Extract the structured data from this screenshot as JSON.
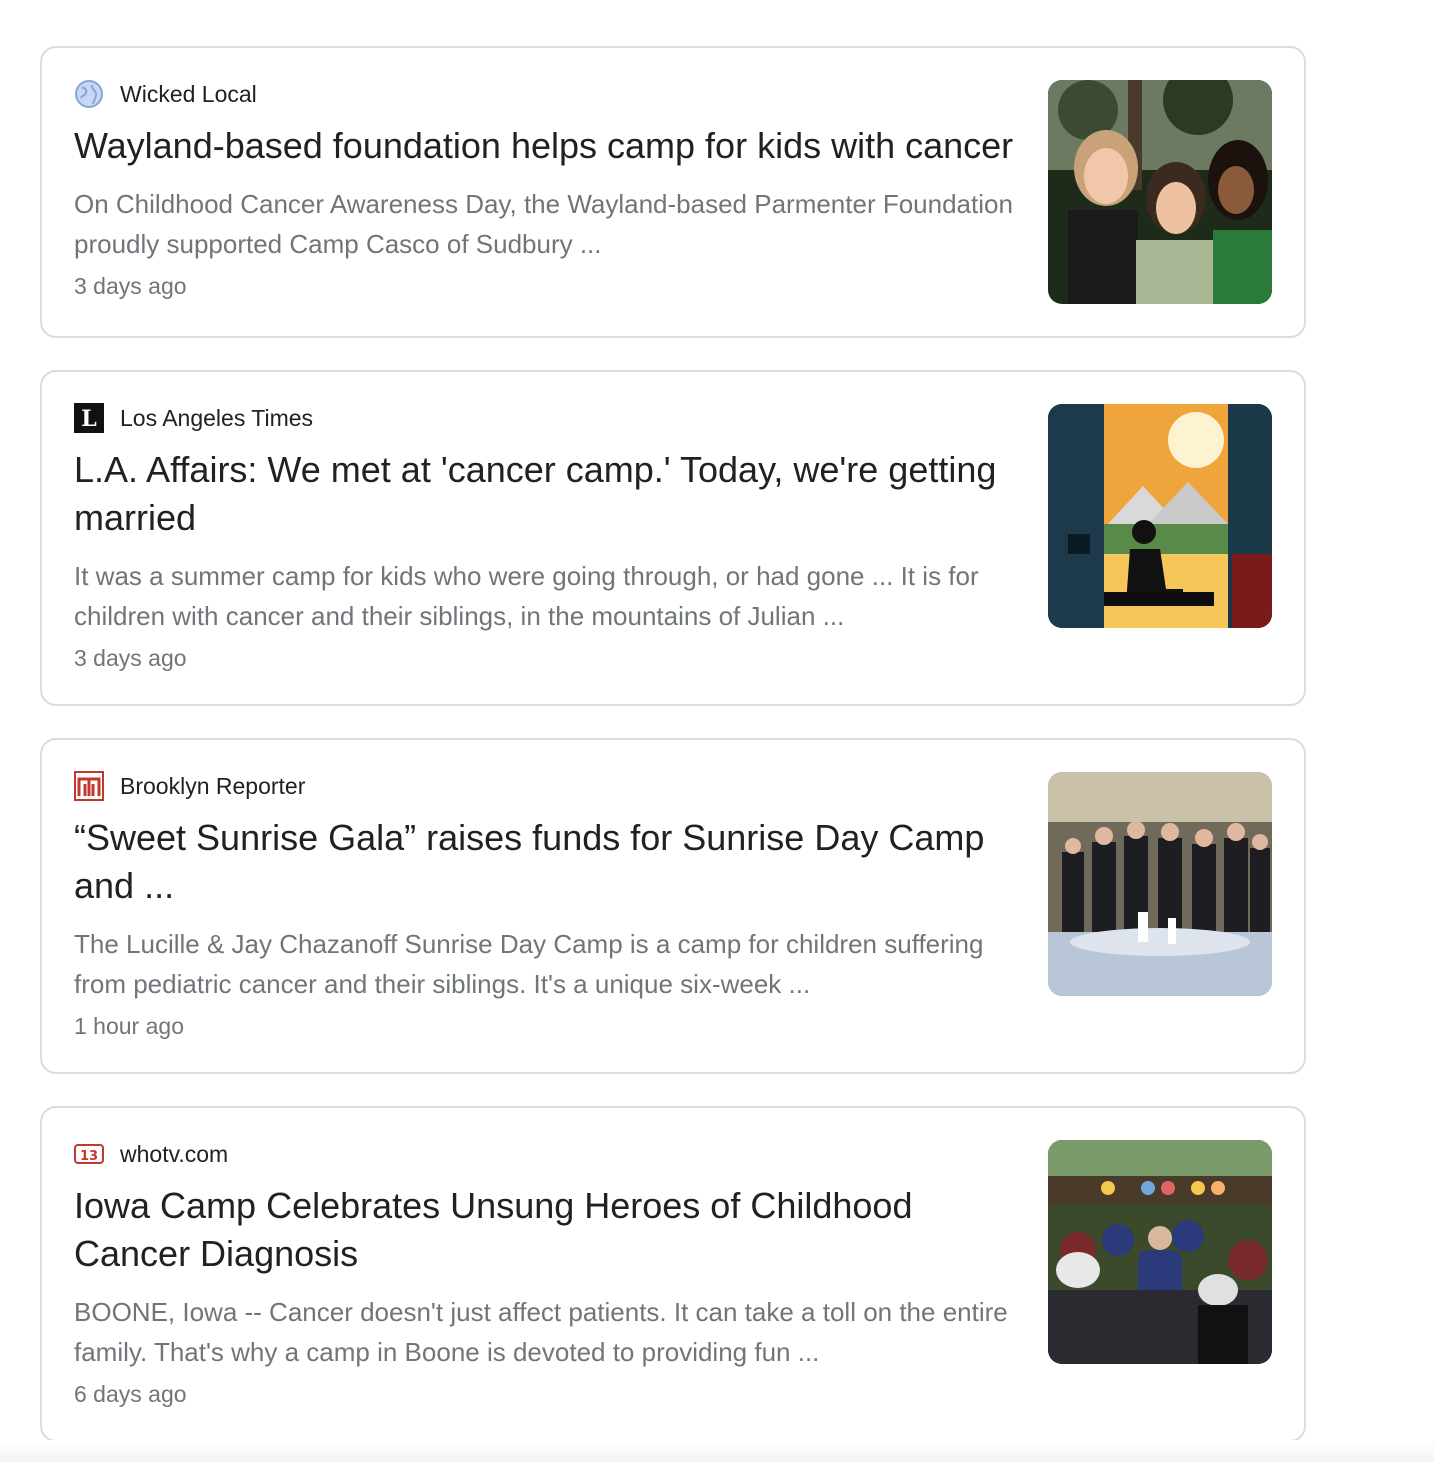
{
  "articles": [
    {
      "source": "Wicked Local",
      "favicon": "globe-icon",
      "headline": "Wayland-based foundation helps camp for kids with cancer",
      "snippet": "On Childhood Cancer Awareness Day, the Wayland-based Parmenter Foundation proudly supported Camp Casco of Sudbury ...",
      "time": "3 days ago",
      "thumbnail": "three-girls-smiling-photo"
    },
    {
      "source": "Los Angeles Times",
      "favicon": "la-times-icon",
      "headline": "L.A. Affairs: We met at 'cancer camp.' Today, we're getting married",
      "snippet": "It was a summer camp for kids who were going through, or had gone ... It is for children with cancer and their siblings, in the mountains of Julian ...",
      "time": "3 days ago",
      "thumbnail": "sunset-window-silhouette-illustration"
    },
    {
      "source": "Brooklyn Reporter",
      "favicon": "brooklyn-reporter-icon",
      "headline": "“Sweet Sunrise Gala” raises funds for Sunrise Day Camp and ...",
      "snippet": "The Lucille & Jay Chazanoff Sunrise Day Camp is a camp for children suffering from pediatric cancer and their siblings. It's a unique six-week ...",
      "time": "1 hour ago",
      "thumbnail": "gala-group-photo"
    },
    {
      "source": "whotv.com",
      "favicon": "whotv-13-icon",
      "headline": "Iowa Camp Celebrates Unsung Heroes of Childhood Cancer Diagnosis",
      "snippet": "BOONE, Iowa -- Cancer doesn't just affect patients. It can take a toll on the entire family. That's why a camp in Boone is devoted to providing fun ...",
      "time": "6 days ago",
      "thumbnail": "camp-crowd-photo"
    }
  ],
  "colors": {
    "headline": "#202124",
    "snippet": "#70757a",
    "border": "#dadce0"
  }
}
